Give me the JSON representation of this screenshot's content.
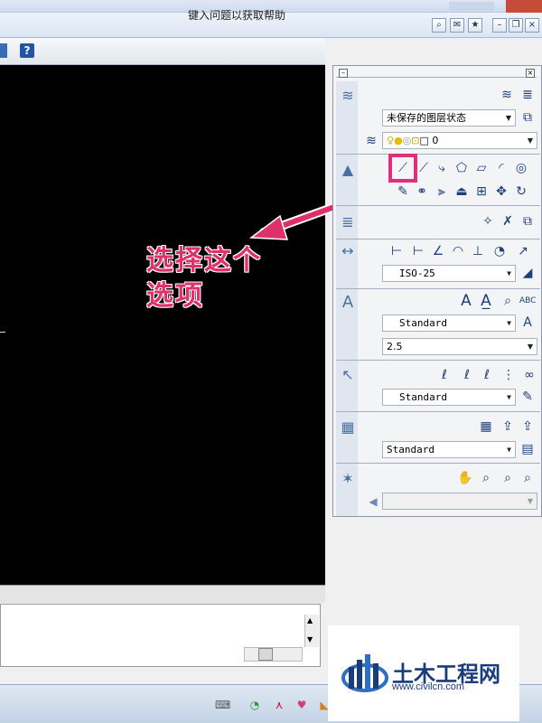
{
  "help_bar": {
    "prompt": "键入问题以获取帮助"
  },
  "toolbar": {
    "help_glyph": "?"
  },
  "annotation": {
    "line1": "选择这个",
    "line2": "选项"
  },
  "palette": {
    "layers": {
      "state": "未保存的图层状态",
      "current_layer": "0"
    },
    "dimensions": {
      "style": "ISO-25"
    },
    "text": {
      "style": "Standard",
      "height": "2.5",
      "large_a": "A"
    },
    "multileader": {
      "style": "Standard"
    },
    "table": {
      "style": "Standard"
    },
    "view": {
      "value": ""
    }
  },
  "watermark": {
    "title": "土木工程网",
    "url": "www.civilcn.com"
  },
  "colors": {
    "accent": "#e0306c",
    "canvas": "#000000",
    "watermark_blue": "#1a3c7a"
  }
}
